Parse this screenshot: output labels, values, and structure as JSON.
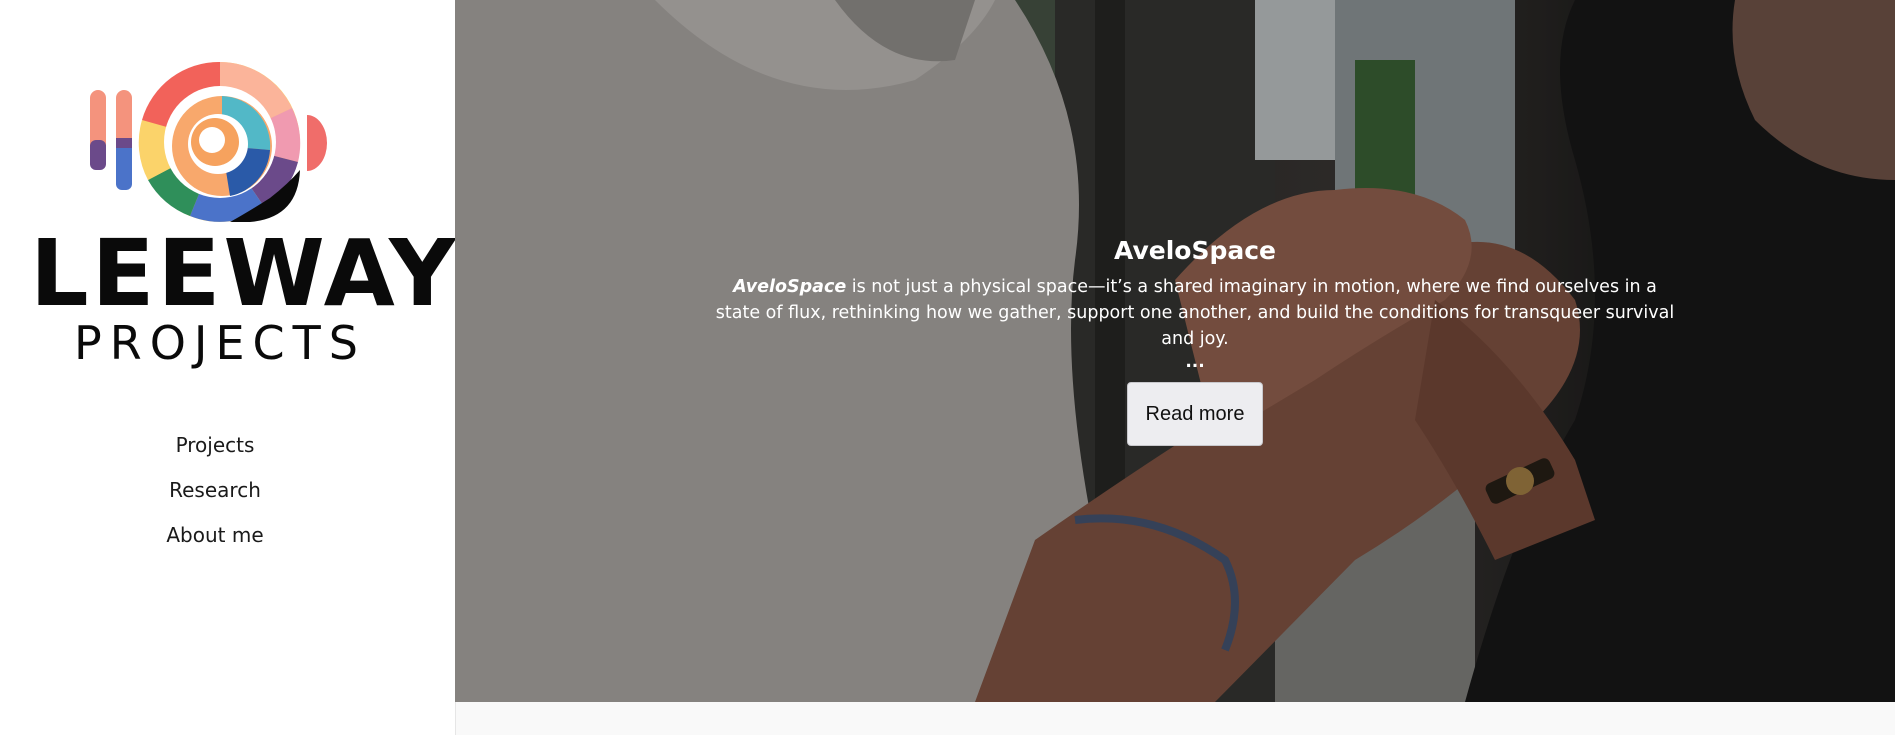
{
  "brand": {
    "name_main": "LEEWAY",
    "name_sub": "PROJECTS",
    "logo_icon": "rainbow-spiral-logo-icon"
  },
  "nav": {
    "items": [
      {
        "label": "Projects"
      },
      {
        "label": "Research"
      },
      {
        "label": "About me"
      }
    ]
  },
  "hero": {
    "title": "AveloSpace",
    "desc_emphasis": "AveloSpace",
    "desc_rest": " is not just a physical space—it’s a shared imaginary in motion, where we find ourselves in a state of flux, rethinking how we gather, support one another, and build the conditions for transqueer survival and joy.",
    "ellipsis": "...",
    "button_label": "Read more",
    "image_description_icon": "hands-holding-photo"
  },
  "colors": {
    "sidebar_bg": "#ffffff",
    "text_dark": "#0a0a0a",
    "hero_text": "#ffffff",
    "button_bg": "#ededf0"
  }
}
